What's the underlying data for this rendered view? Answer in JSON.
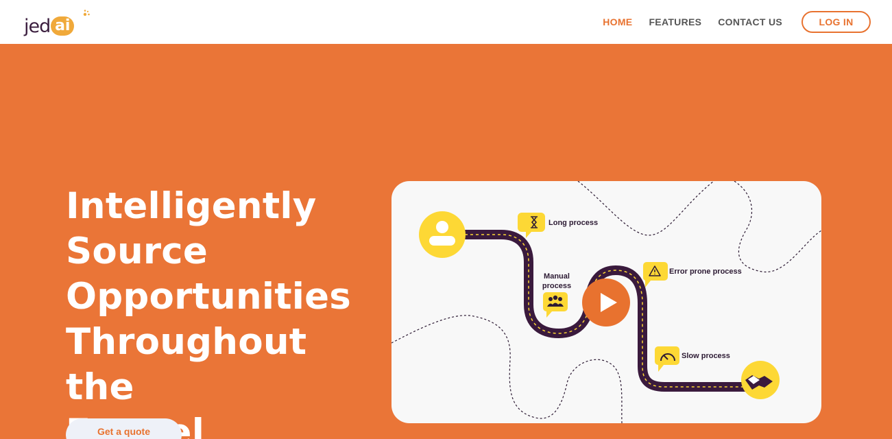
{
  "brand": {
    "logo_text": "jed",
    "logo_accent": "ai"
  },
  "nav": {
    "links": [
      {
        "label": "HOME",
        "active": true
      },
      {
        "label": "FEATURES",
        "active": false
      },
      {
        "label": "CONTACT US",
        "active": false
      }
    ],
    "login_label": "LOG IN"
  },
  "hero": {
    "title_lines": [
      "Intelligently",
      "Source",
      "Opportunities",
      "Throughout the",
      "Funnel"
    ],
    "cta_label": "Get a quote"
  },
  "video": {
    "labels": {
      "long_process": "Long process",
      "manual_process_line1": "Manual",
      "manual_process_line2": "process",
      "error_prone": "Error prone process",
      "slow_process": "Slow process"
    },
    "icons": [
      "user-icon",
      "hourglass-icon",
      "team-icon",
      "warning-icon",
      "speedometer-icon",
      "handshake-icon",
      "play-icon"
    ]
  },
  "colors": {
    "accent": "#e8722f",
    "hero_bg": "#ea7537",
    "road": "#3a1a3d",
    "yellow": "#fdd835"
  }
}
